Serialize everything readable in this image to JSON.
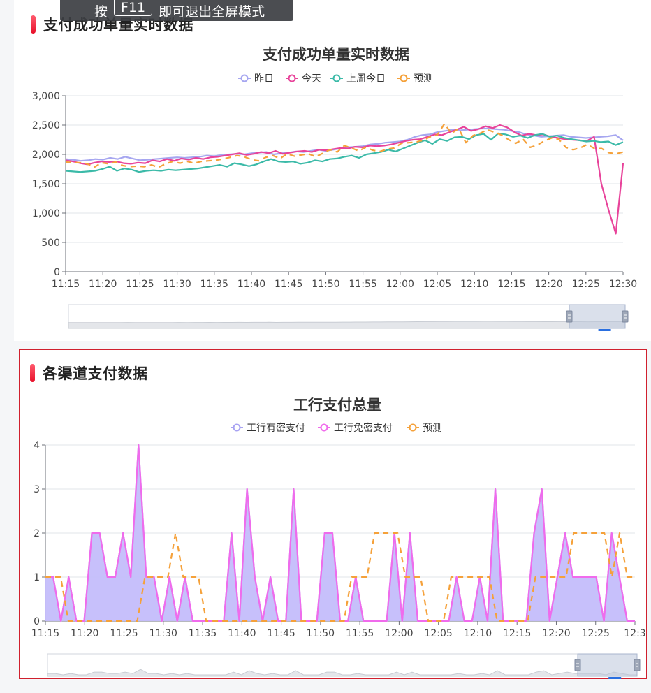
{
  "toast": {
    "before": "按",
    "key": "F11",
    "after": "即可退出全屏模式"
  },
  "sections": [
    {
      "title": "支付成功单量实时数据"
    },
    {
      "title": "各渠道支付数据"
    }
  ],
  "chart_data": [
    {
      "type": "line",
      "title": "支付成功单量实时数据",
      "xlabel": "",
      "ylabel": "",
      "x_ticks": [
        "11:15",
        "11:20",
        "11:25",
        "11:30",
        "11:35",
        "11:40",
        "11:45",
        "11:50",
        "11:55",
        "12:00",
        "12:05",
        "12:10",
        "12:15",
        "12:20",
        "12:25",
        "12:30"
      ],
      "x_range": [
        "11:15",
        "12:30"
      ],
      "ylim": [
        0,
        3000
      ],
      "y_ticks": [
        "0",
        "500",
        "1,000",
        "1,500",
        "2,000",
        "2,500",
        "3,000"
      ],
      "grid": true,
      "legend_position": "top-center",
      "series": [
        {
          "name": "昨日",
          "color": "#a6a6f0",
          "dashed": false,
          "values": [
            1920,
            1910,
            1890,
            1900,
            1920,
            1910,
            1940,
            1920,
            1960,
            1930,
            1900,
            1910,
            1920,
            1930,
            1940,
            1950,
            1940,
            1950,
            1960,
            1980,
            1970,
            1990,
            2000,
            2010,
            2000,
            2020,
            2030,
            2040,
            2000,
            2020,
            2030,
            2050,
            2040,
            2060,
            2080,
            2060,
            2080,
            2100,
            2120,
            2130,
            2140,
            2170,
            2180,
            2200,
            2210,
            2220,
            2250,
            2300,
            2330,
            2340,
            2380,
            2400,
            2420,
            2410,
            2420,
            2430,
            2440,
            2440,
            2430,
            2420,
            2400,
            2380,
            2340,
            2320,
            2300,
            2310,
            2320,
            2330,
            2300,
            2290,
            2280,
            2290,
            2300,
            2310,
            2330,
            2240
          ]
        },
        {
          "name": "今天",
          "color": "#e8439a",
          "dashed": false,
          "values": [
            1900,
            1880,
            1850,
            1830,
            1860,
            1880,
            1870,
            1880,
            1850,
            1840,
            1860,
            1850,
            1900,
            1880,
            1920,
            1890,
            1930,
            1910,
            1940,
            1920,
            1950,
            1960,
            1980,
            2000,
            2020,
            1990,
            2010,
            2040,
            2020,
            2060,
            2010,
            2030,
            2050,
            2060,
            2040,
            2080,
            2070,
            2090,
            2110,
            2100,
            2130,
            2120,
            2150,
            2140,
            2150,
            2170,
            2200,
            2230,
            2250,
            2260,
            2300,
            2340,
            2330,
            2380,
            2420,
            2470,
            2400,
            2430,
            2480,
            2450,
            2500,
            2460,
            2380,
            2320,
            2350,
            2330,
            2340,
            2300,
            2280,
            2260,
            2250,
            2240,
            2230,
            2300,
            1500,
            1050,
            650,
            1850
          ]
        },
        {
          "name": "上周今日",
          "color": "#3bbaa8",
          "dashed": false,
          "values": [
            1720,
            1710,
            1700,
            1710,
            1720,
            1750,
            1790,
            1720,
            1760,
            1740,
            1700,
            1720,
            1730,
            1720,
            1740,
            1730,
            1740,
            1750,
            1760,
            1780,
            1800,
            1820,
            1790,
            1850,
            1830,
            1800,
            1830,
            1880,
            1920,
            1880,
            1870,
            1880,
            1840,
            1860,
            1900,
            1880,
            1920,
            1930,
            1960,
            1980,
            1940,
            2000,
            2020,
            2040,
            2080,
            2050,
            2100,
            2150,
            2200,
            2240,
            2180,
            2260,
            2230,
            2290,
            2300,
            2260,
            2330,
            2350,
            2250,
            2360,
            2340,
            2300,
            2320,
            2280,
            2330,
            2350,
            2300,
            2320,
            2280,
            2260,
            2240,
            2220,
            2230,
            2210,
            2220,
            2160,
            2210
          ]
        },
        {
          "name": "预测",
          "color": "#f5a13a",
          "dashed": true,
          "values": [
            1870,
            1860,
            1860,
            1840,
            1780,
            1860,
            1840,
            1870,
            1810,
            1790,
            1800,
            1790,
            1820,
            1780,
            1840,
            1880,
            1850,
            1880,
            1850,
            1880,
            1890,
            1900,
            1920,
            1950,
            1980,
            1960,
            1910,
            1890,
            1950,
            1980,
            1930,
            2010,
            1970,
            1990,
            2010,
            1960,
            2020,
            2080,
            2040,
            2150,
            2110,
            2060,
            2120,
            2070,
            2050,
            2090,
            2110,
            2190,
            2200,
            2210,
            2240,
            2300,
            2330,
            2520,
            2360,
            2440,
            2200,
            2320,
            2360,
            2420,
            2380,
            2330,
            2250,
            2190,
            2260,
            2120,
            2160,
            2230,
            2280,
            2260,
            2120,
            2080,
            2110,
            2170,
            2100,
            2100,
            2030,
            2010,
            2040
          ]
        }
      ]
    },
    {
      "type": "area",
      "title": "工行支付总量",
      "xlabel": "",
      "ylabel": "",
      "x_ticks": [
        "11:15",
        "11:20",
        "11:25",
        "11:30",
        "11:35",
        "11:40",
        "11:45",
        "11:50",
        "11:55",
        "12:00",
        "12:05",
        "12:10",
        "12:15",
        "12:20",
        "12:25",
        "12:3"
      ],
      "x_range": [
        "11:15",
        "12:30"
      ],
      "ylim": [
        0,
        4
      ],
      "y_ticks": [
        "0",
        "1",
        "2",
        "3",
        "4"
      ],
      "grid": true,
      "legend_position": "top-center",
      "series": [
        {
          "name": "工行有密支付",
          "color": "#a7a2f2",
          "fill": "#c4bdfb",
          "dashed": false,
          "values": [
            1,
            1,
            0,
            1,
            0,
            0,
            2,
            2,
            1,
            1,
            2,
            1,
            4,
            1,
            1,
            0,
            1,
            0,
            1,
            0,
            0,
            0,
            0,
            0,
            2,
            0,
            3,
            1,
            0,
            1,
            0,
            0,
            3,
            0,
            0,
            0,
            2,
            2,
            0,
            0,
            1,
            0,
            0,
            0,
            0,
            2,
            0,
            2,
            0,
            0,
            0,
            0,
            0,
            1,
            0,
            0,
            1,
            0,
            3,
            0,
            0,
            0,
            0,
            2,
            3,
            0,
            1,
            2,
            1,
            1,
            1,
            1,
            0,
            2,
            1,
            0,
            0
          ]
        },
        {
          "name": "工行免密支付",
          "color": "#f06bec",
          "dashed": false,
          "values": [
            1,
            1,
            0,
            1,
            0,
            0,
            2,
            2,
            1,
            1,
            2,
            1,
            4,
            1,
            1,
            0,
            1,
            0,
            1,
            0,
            0,
            0,
            0,
            0,
            2,
            0,
            3,
            1,
            0,
            1,
            0,
            0,
            3,
            0,
            0,
            0,
            2,
            2,
            0,
            0,
            1,
            0,
            0,
            0,
            0,
            2,
            0,
            2,
            0,
            0,
            0,
            0,
            0,
            1,
            0,
            0,
            1,
            0,
            3,
            0,
            0,
            0,
            0,
            2,
            3,
            0,
            1,
            2,
            1,
            1,
            1,
            1,
            0,
            2,
            1,
            0,
            0
          ]
        },
        {
          "name": "预测",
          "color": "#f5a13a",
          "dashed": true,
          "values": [
            1,
            1,
            1,
            0,
            0,
            0,
            0,
            0,
            0,
            0,
            0,
            0,
            0,
            1,
            1,
            1,
            1,
            2,
            1,
            1,
            1,
            0,
            0,
            0,
            0,
            0,
            0,
            0,
            0,
            0,
            0,
            0,
            0,
            0,
            0,
            0,
            0,
            0,
            0,
            0,
            1,
            1,
            1,
            2,
            2,
            2,
            2,
            1,
            1,
            1,
            0,
            0,
            0,
            1,
            1,
            1,
            1,
            1,
            1,
            0,
            0,
            0,
            0,
            0,
            1,
            1,
            1,
            1,
            1,
            2,
            2,
            2,
            2,
            2,
            1,
            2,
            1,
            1
          ]
        }
      ]
    }
  ]
}
